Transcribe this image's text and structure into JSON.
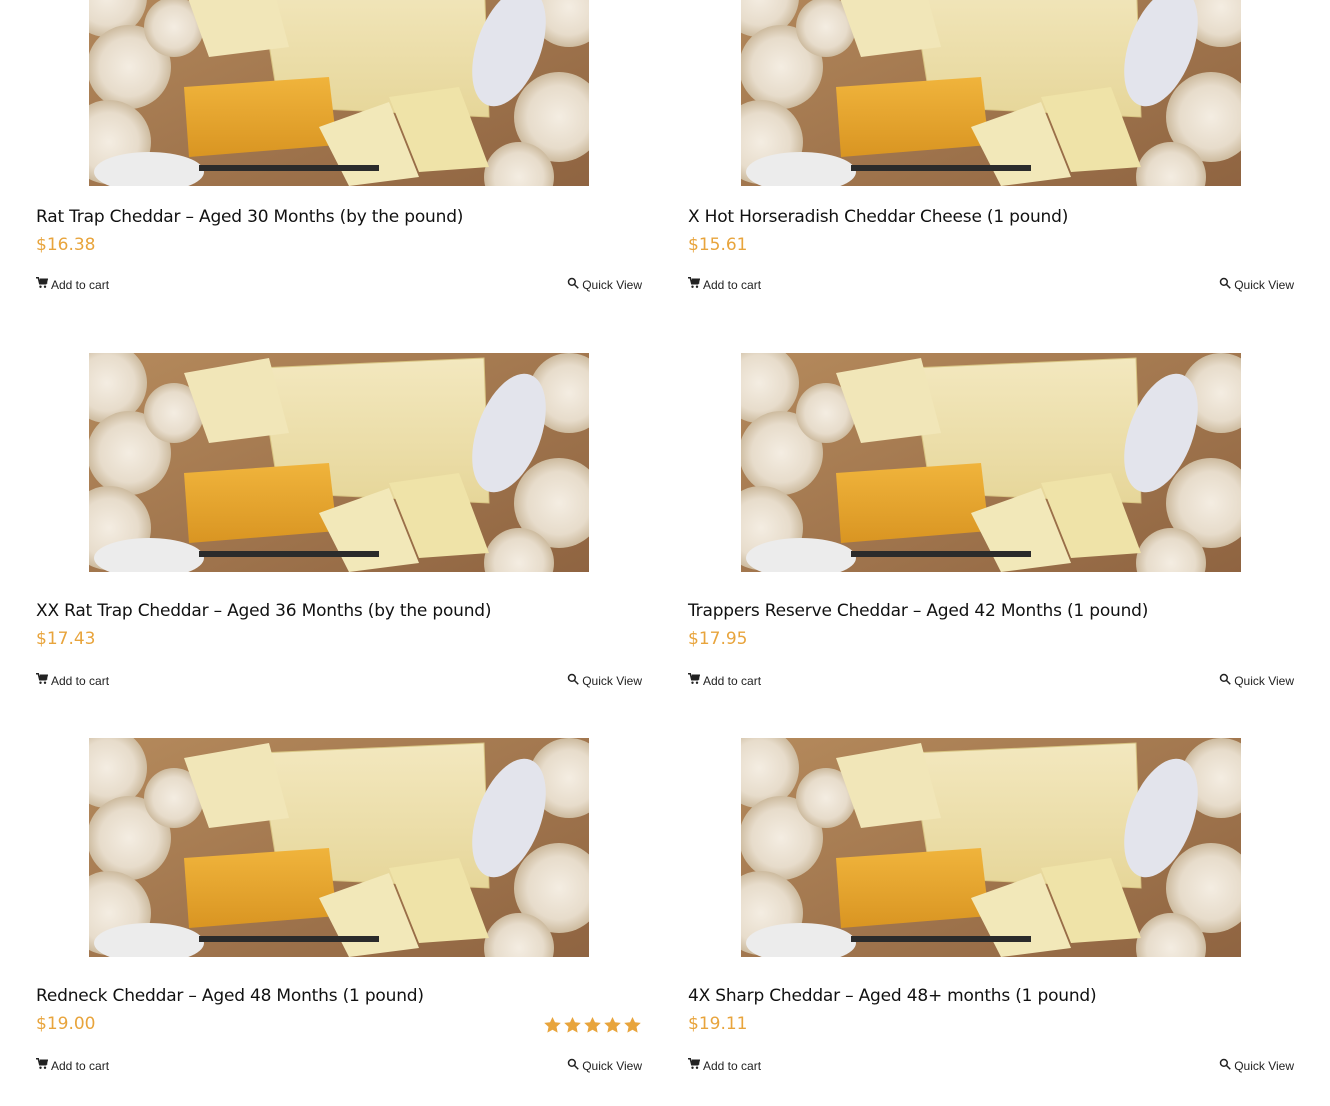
{
  "products": [
    {
      "title": "Rat Trap Cheddar – Aged 30 Months (by the pound)",
      "price": "$16.38",
      "rating": null,
      "add_to_cart": "Add to cart",
      "quick_view": "Quick View",
      "image_icon": "cheese-board-image"
    },
    {
      "title": "X Hot Horseradish Cheddar Cheese (1 pound)",
      "price": "$15.61",
      "rating": null,
      "add_to_cart": "Add to cart",
      "quick_view": "Quick View",
      "image_icon": "cheese-board-image"
    },
    {
      "title": "XX Rat Trap Cheddar – Aged 36 Months (by the pound)",
      "price": "$17.43",
      "rating": null,
      "add_to_cart": "Add to cart",
      "quick_view": "Quick View",
      "image_icon": "cheese-board-image"
    },
    {
      "title": "Trappers Reserve Cheddar – Aged 42 Months (1 pound)",
      "price": "$17.95",
      "rating": null,
      "add_to_cart": "Add to cart",
      "quick_view": "Quick View",
      "image_icon": "cheese-board-image"
    },
    {
      "title": "Redneck Cheddar – Aged 48 Months (1 pound)",
      "price": "$19.00",
      "rating": 5,
      "add_to_cart": "Add to cart",
      "quick_view": "Quick View",
      "image_icon": "cheese-board-image"
    },
    {
      "title": "4X Sharp Cheddar – Aged 48+ months (1 pound)",
      "price": "$19.11",
      "rating": null,
      "add_to_cart": "Add to cart",
      "quick_view": "Quick View",
      "image_icon": "cheese-board-image"
    }
  ],
  "icons": {
    "cart": "shopping-cart-icon",
    "quick_view": "search-icon",
    "star": "star-icon"
  },
  "colors": {
    "price": "#e8a43c",
    "star": "#e8a43c",
    "title": "#111111"
  }
}
